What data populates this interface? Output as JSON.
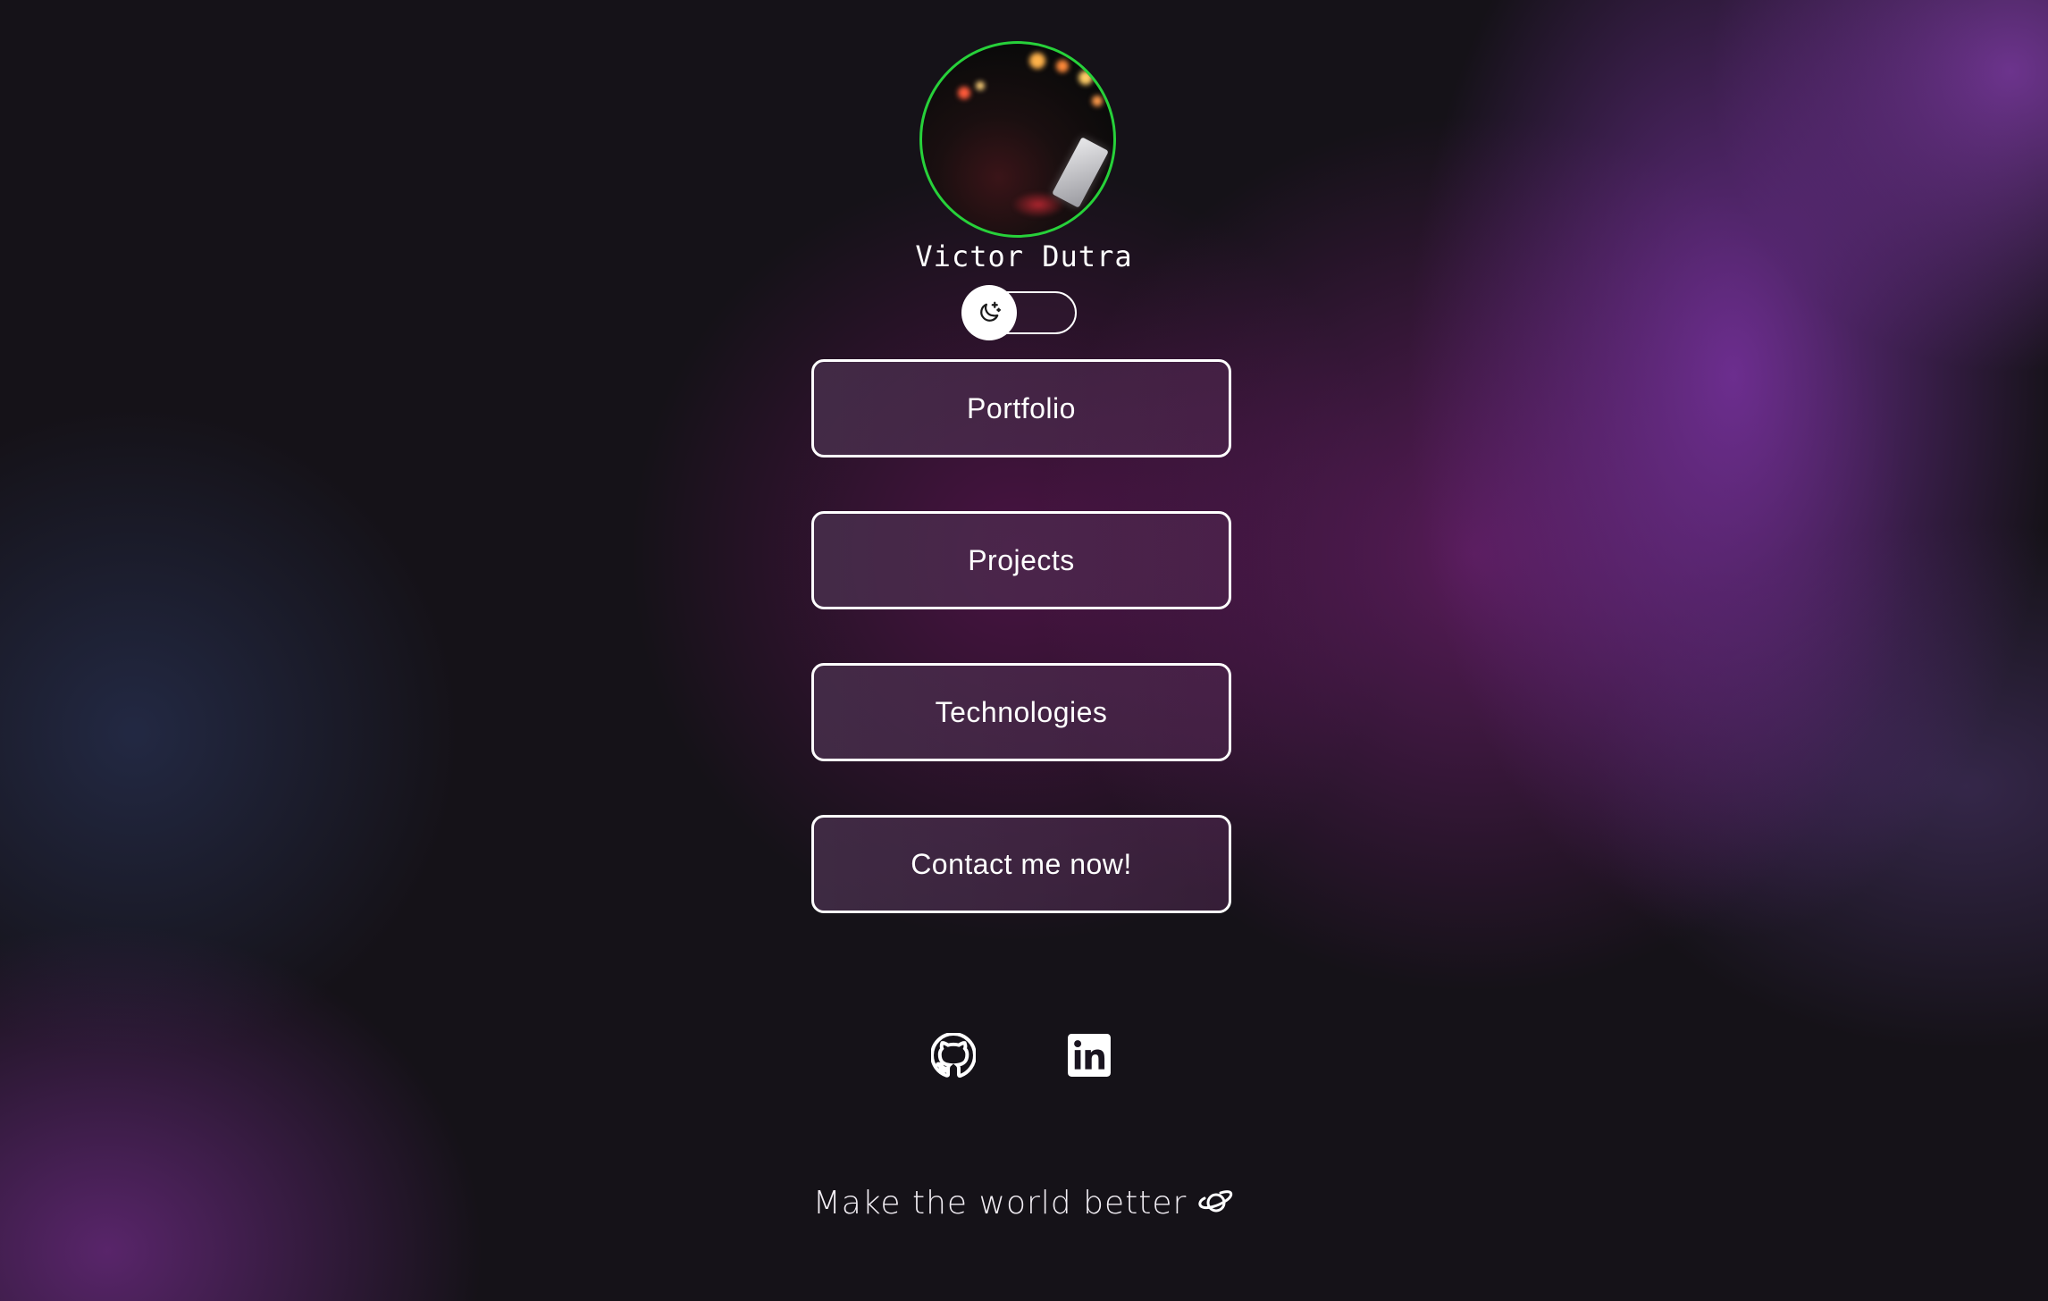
{
  "profile": {
    "name": "Victor Dutra"
  },
  "theme_toggle": {
    "icon": "moon-stars-icon"
  },
  "links": [
    {
      "label": "Portfolio"
    },
    {
      "label": "Projects"
    },
    {
      "label": "Technologies"
    },
    {
      "label": "Contact me now!"
    }
  ],
  "social": [
    {
      "icon": "github-icon"
    },
    {
      "icon": "linkedin-icon"
    }
  ],
  "footer": {
    "tagline": "Make the world better",
    "icon": "planet-icon"
  },
  "colors": {
    "avatar_border": "#27d13a",
    "button_border": "#ffffff",
    "text": "#ffffff"
  }
}
